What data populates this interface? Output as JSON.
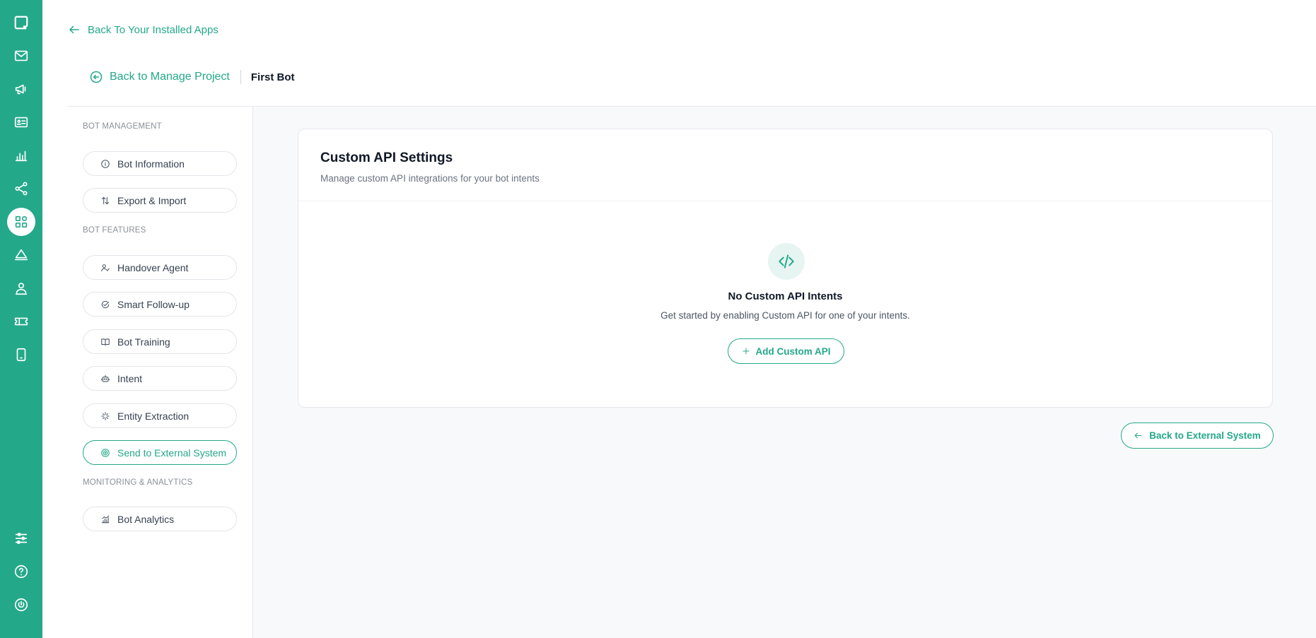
{
  "header": {
    "back_to_apps": "Back To Your Installed Apps",
    "back_to_project": "Back to Manage Project",
    "current_bot": "First Bot"
  },
  "sidebar": {
    "sections": [
      {
        "title": "BOT MANAGEMENT",
        "items": [
          {
            "label": "Bot Information",
            "icon": "info-icon"
          },
          {
            "label": "Export & Import",
            "icon": "arrows-up-down-icon"
          }
        ]
      },
      {
        "title": "BOT FEATURES",
        "items": [
          {
            "label": "Handover Agent",
            "icon": "user-check-icon"
          },
          {
            "label": "Smart Follow-up",
            "icon": "message-check-icon"
          },
          {
            "label": "Bot Training",
            "icon": "book-open-icon"
          },
          {
            "label": "Intent",
            "icon": "robot-icon"
          },
          {
            "label": "Entity Extraction",
            "icon": "sparkle-icon"
          },
          {
            "label": "Send to External System",
            "icon": "target-icon",
            "active": true
          }
        ]
      },
      {
        "title": "MONITORING & ANALYTICS",
        "items": [
          {
            "label": "Bot Analytics",
            "icon": "chart-icon"
          }
        ]
      }
    ]
  },
  "card": {
    "title": "Custom API Settings",
    "subtitle": "Manage custom API integrations for your bot intents",
    "empty_title": "No Custom API Intents",
    "empty_subtitle": "Get started by enabling Custom API for one of your intents.",
    "add_button": "Add Custom API"
  },
  "footer": {
    "back_external": "Back to External System"
  },
  "colors": {
    "accent": "#24a88a",
    "rail": "#24a88a",
    "content_bg": "#f8f9fb"
  }
}
